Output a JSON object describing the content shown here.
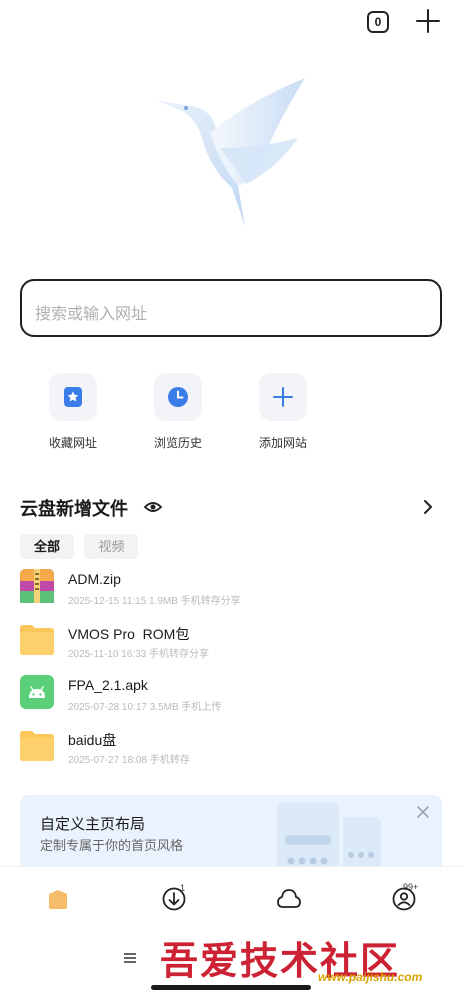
{
  "topbar": {
    "tab_count": "0"
  },
  "search": {
    "placeholder": "搜索或输入网址"
  },
  "shortcuts": [
    {
      "label": "收藏网址",
      "icon": "bookmark-star-icon"
    },
    {
      "label": "浏览历史",
      "icon": "history-clock-icon"
    },
    {
      "label": "添加网站",
      "icon": "add-icon"
    }
  ],
  "cloud_section": {
    "title": "云盘新增文件"
  },
  "filters": [
    {
      "label": "全部",
      "active": true
    },
    {
      "label": "视频",
      "active": false
    }
  ],
  "files": [
    {
      "name": "ADM.zip",
      "meta": "2025-12-15 11:15  1.9MB  手机转存分享",
      "icon": "zip-icon"
    },
    {
      "name": "VMOS Pro  ROM包",
      "meta": "2025-11-10 16:33  手机转存分享",
      "icon": "folder-icon"
    },
    {
      "name": "FPA_2.1.apk",
      "meta": "2025-07-28 10:17  3.5MB  手机上传",
      "icon": "android-apk-icon"
    },
    {
      "name": "baidu盘",
      "meta": "2025-07-27 18:08  手机转存",
      "icon": "folder-icon"
    }
  ],
  "banner": {
    "title": "自定义主页布局",
    "subtitle": "定制专属于你的首页风格"
  },
  "bottom_nav": {
    "download_badge": "1",
    "profile_badge": "99+"
  },
  "watermark": {
    "text": "吾爱技术社区",
    "url": "www.paijishu.com"
  },
  "colors": {
    "accent": "#3b7de8",
    "folder": "#fcc75a",
    "apk": "#5ccf7a",
    "banner_bg": "#eaf3fd"
  }
}
